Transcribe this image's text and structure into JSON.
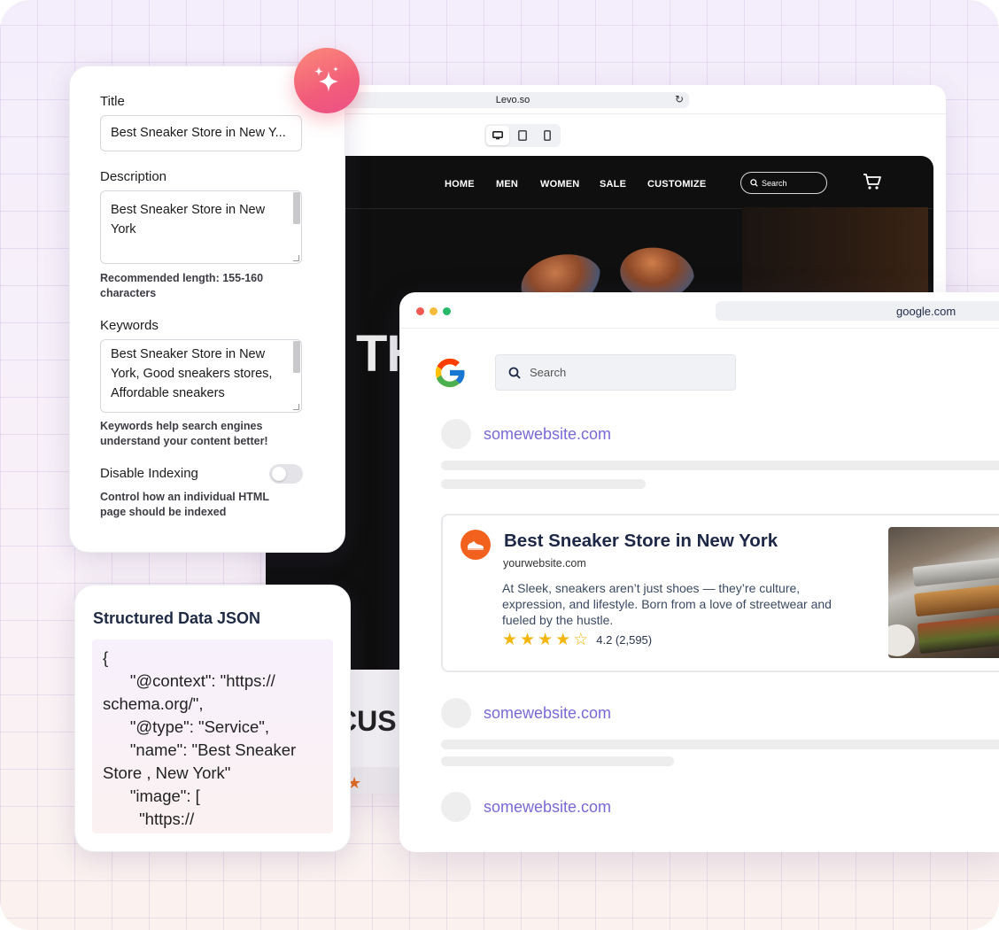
{
  "levo": {
    "url": "Levo.so",
    "nav": [
      "HOME",
      "MEN",
      "WOMEN",
      "SALE",
      "CUSTOMIZE"
    ],
    "search_placeholder": "Search",
    "hero_text": "TH",
    "section_text": "CUS"
  },
  "seo": {
    "title_label": "Title",
    "title_value": "Best Sneaker Store in New Y...",
    "description_label": "Description",
    "description_value": "Best Sneaker Store in New York",
    "description_hint": "Recommended length: 155-160 characters",
    "keywords_label": "Keywords",
    "keywords_value": "Best Sneaker Store in New York, Good sneakers stores, Affordable sneakers",
    "keywords_hint": "Keywords help search engines understand your content better!",
    "indexing_label": "Disable Indexing",
    "indexing_enabled": false,
    "indexing_hint": "Control how an individual HTML page should be indexed"
  },
  "structured_data": {
    "title": "Structured Data JSON",
    "lines": [
      "{",
      "      \"@context\": \"https://",
      "schema.org/\",",
      "      \"@type\": \"Service\",",
      "      \"name\": \"Best Sneaker",
      "Store , New York\"",
      "      \"image\": [",
      "        \"https://"
    ]
  },
  "google": {
    "url": "google.com",
    "search_placeholder": "Search",
    "sites": [
      "somewebsite.com",
      "somewebsite.com",
      "somewebsite.com"
    ],
    "result": {
      "title": "Best Sneaker Store in New York",
      "url": "yourwebsite.com",
      "description": "At Sleek, sneakers aren’t just shoes — they’re culture, expression, and lifestyle. Born from a love of streetwear and fueled by the hustle.",
      "rating_value": 4.2,
      "rating_text": "4.2 (2,595)",
      "stars_filled": 4,
      "stars_total": 5
    }
  },
  "colors": {
    "accent_link": "#7a68d6",
    "result_icon": "#f2611d",
    "star": "#f3b60e",
    "sparkle_gradient_start": "#fb8a7a",
    "sparkle_gradient_end": "#ec4f86"
  },
  "icons": {
    "sparkle": "sparkles-icon",
    "cart": "cart-icon",
    "search": "search-icon",
    "result_favicon": "sneaker-icon",
    "reload": "reload-icon"
  }
}
